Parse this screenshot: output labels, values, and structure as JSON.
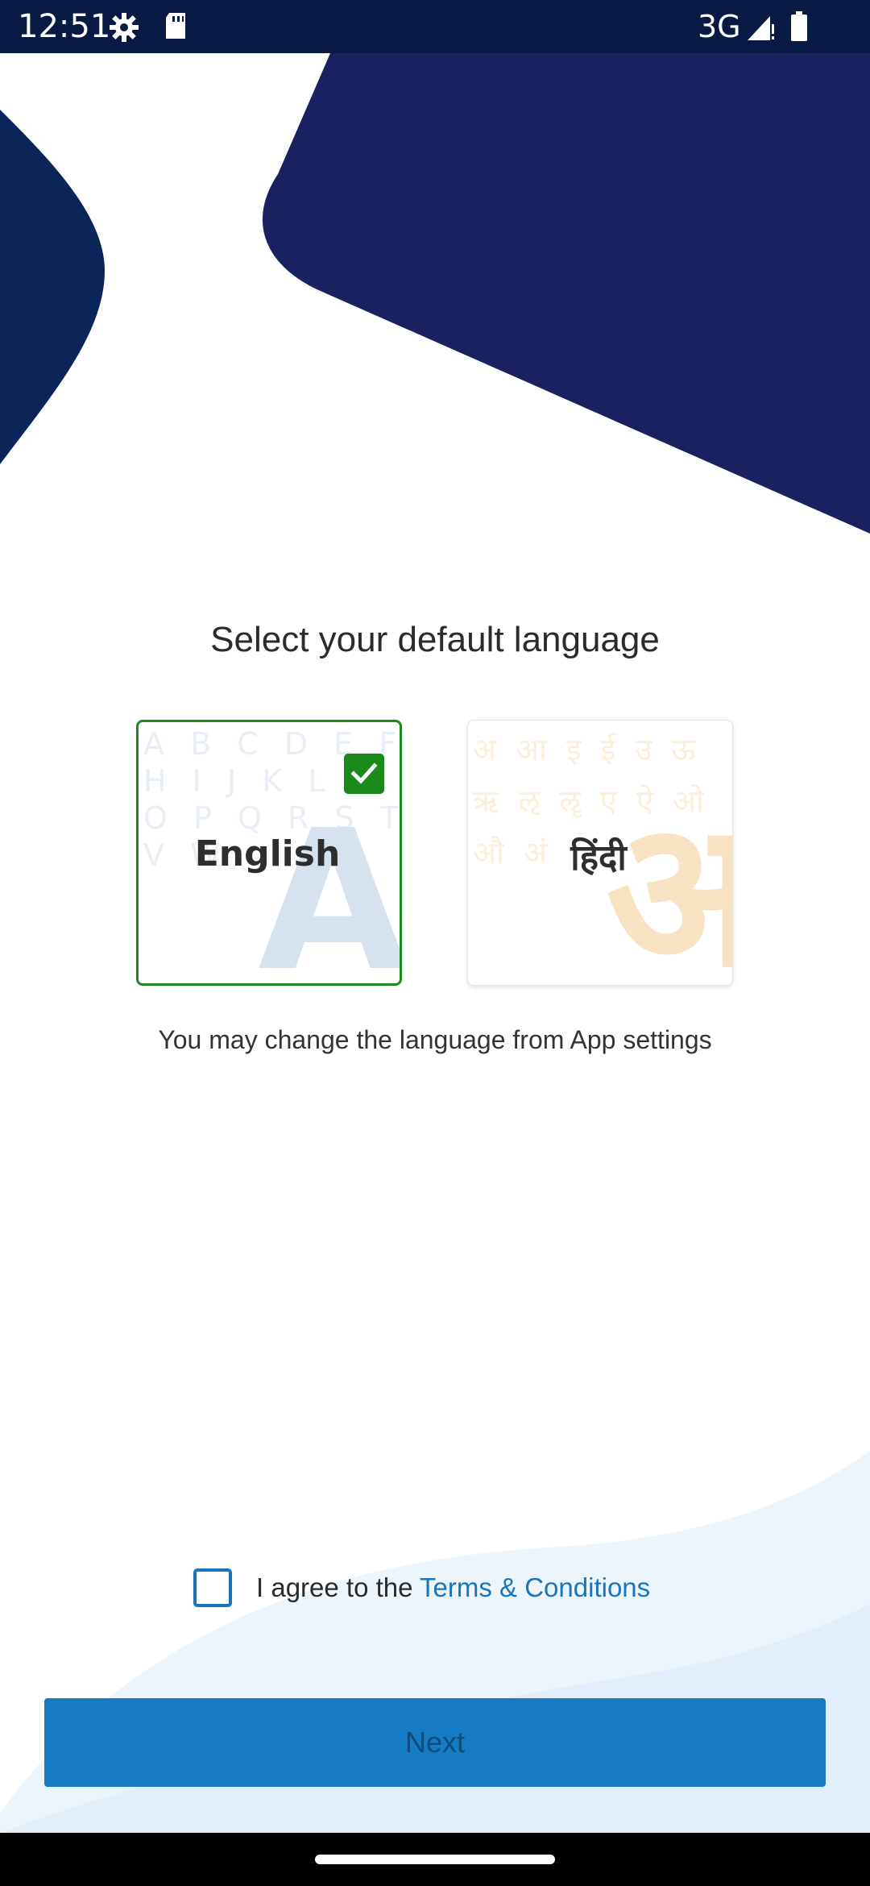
{
  "status_bar": {
    "time": "12:51",
    "network": "3G",
    "icons": [
      "settings-gear-icon",
      "sd-card-icon",
      "cell-signal-icon",
      "battery-icon"
    ]
  },
  "colors": {
    "navy": "#1a2160",
    "status_bg": "#081a44",
    "accent_blue": "#1a75bc",
    "button_blue": "#167bc2",
    "check_green": "#1a8a1a"
  },
  "language_screen": {
    "title": "Select your default language",
    "options": [
      {
        "label": "English",
        "selected": true,
        "background_letters": "A B C D E F G\nH I J K L M N\nO P Q R S T U\nV W",
        "big_glyph": "A"
      },
      {
        "label": "हिंदी",
        "selected": false,
        "background_letters": "अ आ इ ई उ ऊ\nऋ ऌ ॡ ए ऐ ओ\nऔ अं",
        "big_glyph": "अ"
      }
    ],
    "hint": "You may change the language from App settings"
  },
  "terms": {
    "checked": false,
    "prefix": "I agree to the ",
    "link_text": "Terms & Conditions"
  },
  "next_button": {
    "label": "Next",
    "enabled": false
  }
}
